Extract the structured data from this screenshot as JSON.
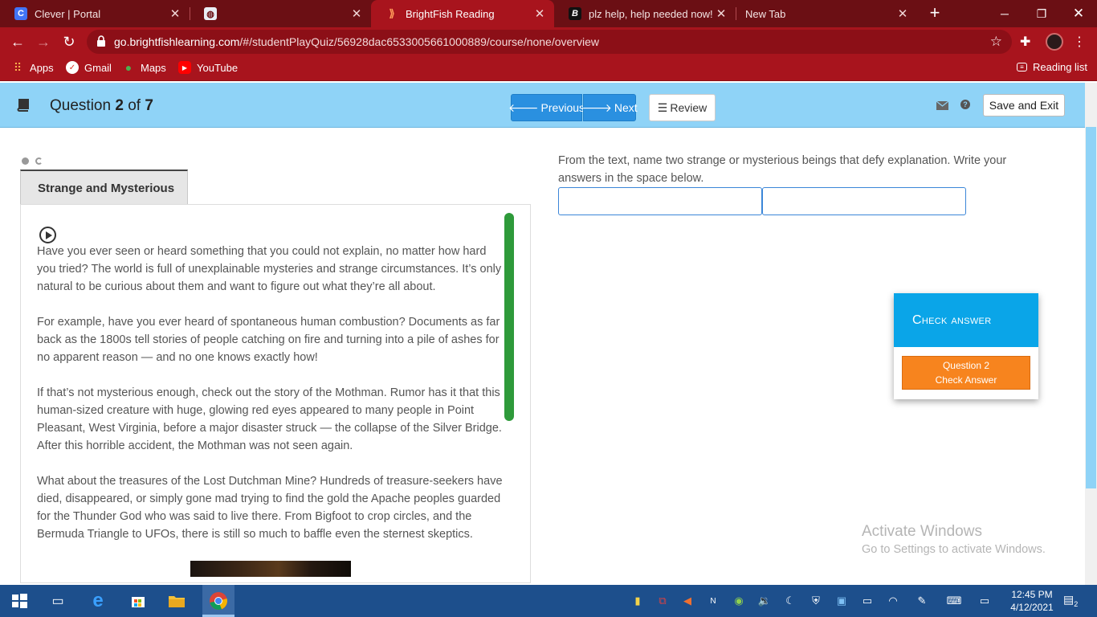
{
  "browser": {
    "tabs": [
      {
        "title": "Clever | Portal",
        "favicon": "C"
      },
      {
        "title": "",
        "favicon": "globe"
      },
      {
        "title": "BrightFish Reading",
        "favicon": "bf"
      },
      {
        "title": "plz help, help needed now! - B",
        "favicon": "B"
      },
      {
        "title": "New Tab",
        "favicon": ""
      }
    ],
    "new_tab_symbol": "+",
    "url_host": "go.brightfishlearning.com",
    "url_path": "/#/studentPlayQuiz/56928dac6533005661000889/course/none/overview",
    "bookmarks": [
      "Apps",
      "Gmail",
      "Maps",
      "YouTube"
    ],
    "reading_list": "Reading list"
  },
  "header": {
    "question_prefix": "Question",
    "question_current": "2",
    "question_of": "of",
    "question_total": "7",
    "previous_label": "Previous",
    "next_label": "Next",
    "review_label": "Review",
    "save_exit_label": "Save and Exit"
  },
  "passage": {
    "title": "Strange and Mysterious",
    "paragraphs": [
      "Have you ever seen or heard something that you could not explain, no matter how hard you tried? The world is full of unexplainable mysteries and strange circumstances. It’s only natural to be curious about them and want to figure out what they’re all about.",
      "For example, have you ever heard of spontaneous human combustion? Documents as far back as the 1800s tell stories of people catching on fire and turning into a pile of ashes for no apparent reason — and no one knows exactly how!",
      "If that’s not mysterious enough, check out the story of the Mothman. Rumor has it that this human-sized creature with huge, glowing red eyes appeared to many people in Point Pleasant, West Virginia, before a major disaster struck — the collapse of the Silver Bridge. After this horrible accident, the Mothman was not seen again.",
      "What about the treasures of the Lost Dutchman Mine? Hundreds of treasure-seekers have died, disappeared, or simply gone mad trying to find the gold the Apache peoples guarded for the Thunder God who was said to live there. From Bigfoot to crop circles, and the Bermuda Triangle to UFOs, there is still so much to baffle even the sternest skeptics."
    ]
  },
  "question": {
    "prompt": "From the text, name two strange or mysterious beings that defy explanation. Write your answers in the space below.",
    "answer1": "",
    "answer2": ""
  },
  "check": {
    "heading": "Check answer",
    "button_line1": "Question 2",
    "button_line2": "Check Answer"
  },
  "watermark": {
    "line1": "Activate Windows",
    "line2": "Go to Settings to activate Windows."
  },
  "taskbar": {
    "time": "12:45 PM",
    "date": "4/12/2021",
    "notifications": "2"
  },
  "colors": {
    "chrome_dark": "#6b0f14",
    "chrome": "#a8141d",
    "header_bg": "#8fd3f7",
    "nav_button": "#2a90e0",
    "check_head": "#0aa5e8",
    "check_button": "#f7841e",
    "passage_scroll": "#2e9a3a",
    "taskbar": "#1d4f8c"
  }
}
